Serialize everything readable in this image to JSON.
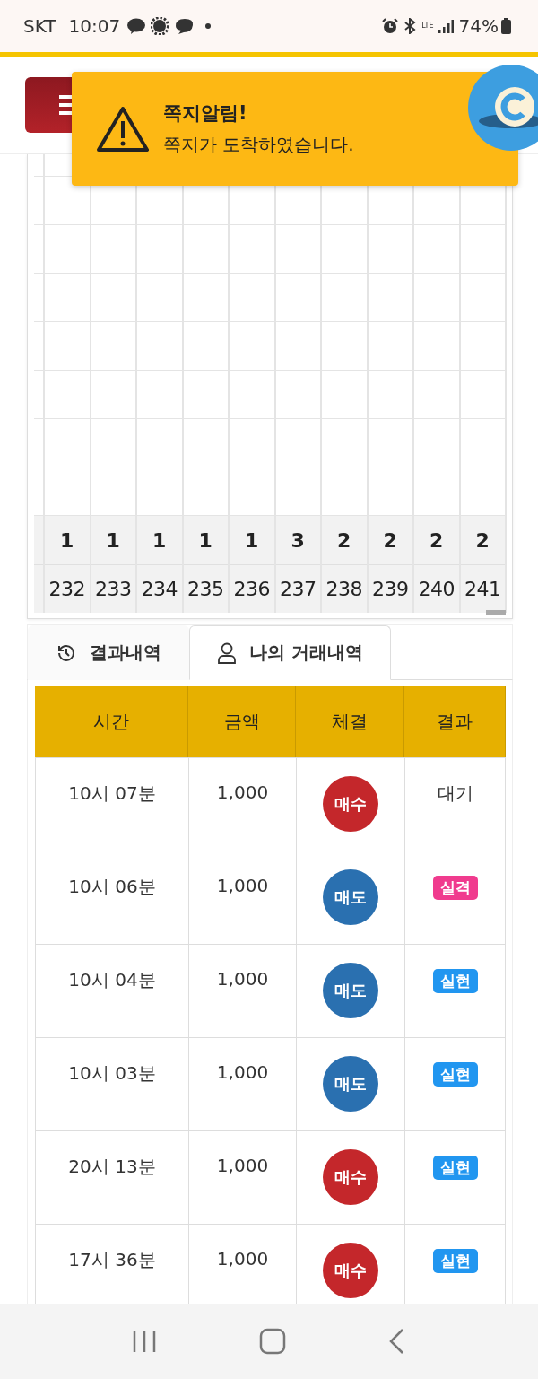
{
  "status_bar": {
    "carrier": "SKT",
    "time": "10:07",
    "network": "LTE",
    "battery": "74%"
  },
  "toast": {
    "title": "쪽지알림!",
    "message": "쪽지가 도착하였습니다."
  },
  "chart": {
    "counts": [
      "1",
      "1",
      "1",
      "1",
      "1",
      "3",
      "2",
      "2",
      "2",
      "2"
    ],
    "rounds": [
      "232",
      "233",
      "234",
      "235",
      "236",
      "237",
      "238",
      "239",
      "240",
      "241"
    ]
  },
  "tabs": [
    {
      "label": "결과내역",
      "selected": false
    },
    {
      "label": "나의 거래내역",
      "selected": true
    }
  ],
  "table": {
    "columns": [
      "시간",
      "금액",
      "체결",
      "결과"
    ],
    "rows": [
      {
        "time": "10시 07분",
        "amount": "1,000",
        "trade": {
          "label": "매수",
          "kind": "buy"
        },
        "result": {
          "label": "대기",
          "kind": "plain"
        }
      },
      {
        "time": "10시 06분",
        "amount": "1,000",
        "trade": {
          "label": "매도",
          "kind": "sell"
        },
        "result": {
          "label": "실격",
          "kind": "fail"
        }
      },
      {
        "time": "10시 04분",
        "amount": "1,000",
        "trade": {
          "label": "매도",
          "kind": "sell"
        },
        "result": {
          "label": "실현",
          "kind": "win"
        }
      },
      {
        "time": "10시 03분",
        "amount": "1,000",
        "trade": {
          "label": "매도",
          "kind": "sell"
        },
        "result": {
          "label": "실현",
          "kind": "win"
        }
      },
      {
        "time": "20시 13분",
        "amount": "1,000",
        "trade": {
          "label": "매수",
          "kind": "buy"
        },
        "result": {
          "label": "실현",
          "kind": "win"
        }
      },
      {
        "time": "17시 36분",
        "amount": "1,000",
        "trade": {
          "label": "매수",
          "kind": "buy"
        },
        "result": {
          "label": "실현",
          "kind": "win"
        }
      }
    ]
  }
}
